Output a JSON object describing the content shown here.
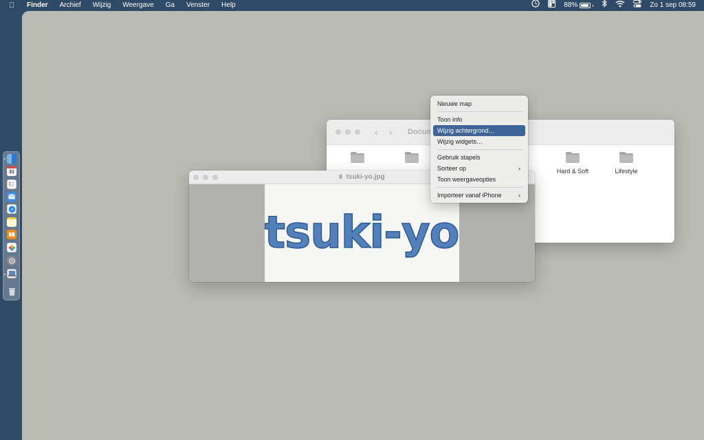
{
  "menubar": {
    "apple_icon": "apple-logo-icon",
    "items": [
      "Finder",
      "Archief",
      "Wijzig",
      "Weergave",
      "Ga",
      "Venster",
      "Help"
    ],
    "status": {
      "battery_percent": "88%",
      "battery_level": 0.88,
      "date_time": "Zo 1 sep  08:59",
      "icons": [
        "clock-icon",
        "layout-icon",
        "battery-icon",
        "bluetooth-icon",
        "wifi-icon",
        "control-center-icon"
      ]
    }
  },
  "dock": {
    "items": [
      "finder-icon",
      "calendar-icon",
      "reminders-icon",
      "mail-icon",
      "safari-icon",
      "notes-icon",
      "books-icon",
      "photos-icon",
      "settings-icon",
      "preview-icon",
      "trash-icon"
    ],
    "calendar_day": "31"
  },
  "finder_window": {
    "title": "Docum",
    "folders": [
      "",
      "",
      "Hard & Soft",
      "Lifestyle"
    ]
  },
  "preview_window": {
    "title": "tsuki-yo.jpg",
    "image_text": "tsuki-yo"
  },
  "context_menu": {
    "items": [
      {
        "label": "Nieuwe map"
      },
      {
        "label": "Toon info"
      },
      {
        "label": "Wijzig achtergrond…",
        "selected": true
      },
      {
        "label": "Wijzig widgets…"
      },
      {
        "label": "Gebruik stapels"
      },
      {
        "label": "Sorteer op",
        "submenu": true
      },
      {
        "label": "Toon weergaveopties"
      },
      {
        "label": "Importeer vanaf iPhone",
        "submenu": true
      }
    ]
  },
  "colors": {
    "menubar": "#2f4a66",
    "desktop": "#b9bbb4",
    "selection": "#3f6596",
    "ink": "#3d6fb0"
  }
}
